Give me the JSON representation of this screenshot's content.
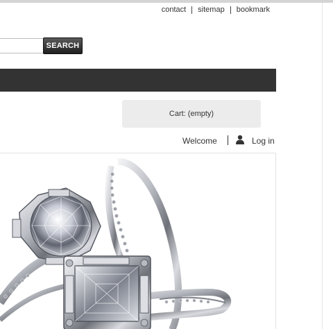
{
  "header": {
    "links": [
      {
        "label": "contact"
      },
      {
        "label": "sitemap"
      },
      {
        "label": "bookmark"
      }
    ]
  },
  "search": {
    "value": "",
    "button_label": "SEARCH"
  },
  "cart": {
    "label": "Cart: (empty)"
  },
  "account": {
    "welcome": "Welcome",
    "login_label": "Log in",
    "user_icon": "user-icon"
  },
  "hero": {
    "image": "diamond-rings-photo"
  },
  "colors": {
    "nav_bar": "#333333",
    "cart_bg": "#ececec",
    "button_dark": "#1f1f1f"
  }
}
